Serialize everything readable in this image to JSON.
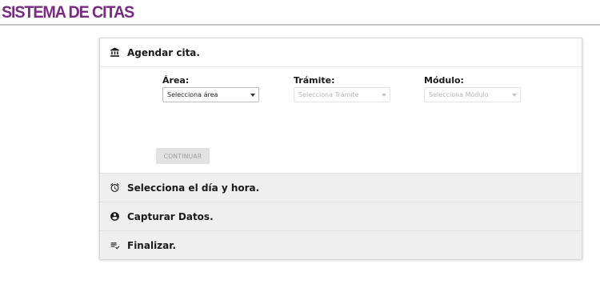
{
  "header": {
    "title": "SISTEMA DE CITAS",
    "title_color": "#7a2a82"
  },
  "steps": [
    {
      "label": "Agendar cita.",
      "icon": "bank-icon"
    },
    {
      "label": "Selecciona el día y hora.",
      "icon": "alarm-clock-icon"
    },
    {
      "label": "Capturar Datos.",
      "icon": "account-circle-icon"
    },
    {
      "label": "Finalizar.",
      "icon": "playlist-check-icon"
    }
  ],
  "form": {
    "area": {
      "label": "Área:",
      "value": "Selecciona área"
    },
    "tramite": {
      "label": "Trámite:",
      "value": "Selecciona Trámite"
    },
    "modulo": {
      "label": "Módulo:",
      "value": "Selecciona Módulo"
    },
    "continue_label": "CONTINUAR"
  }
}
